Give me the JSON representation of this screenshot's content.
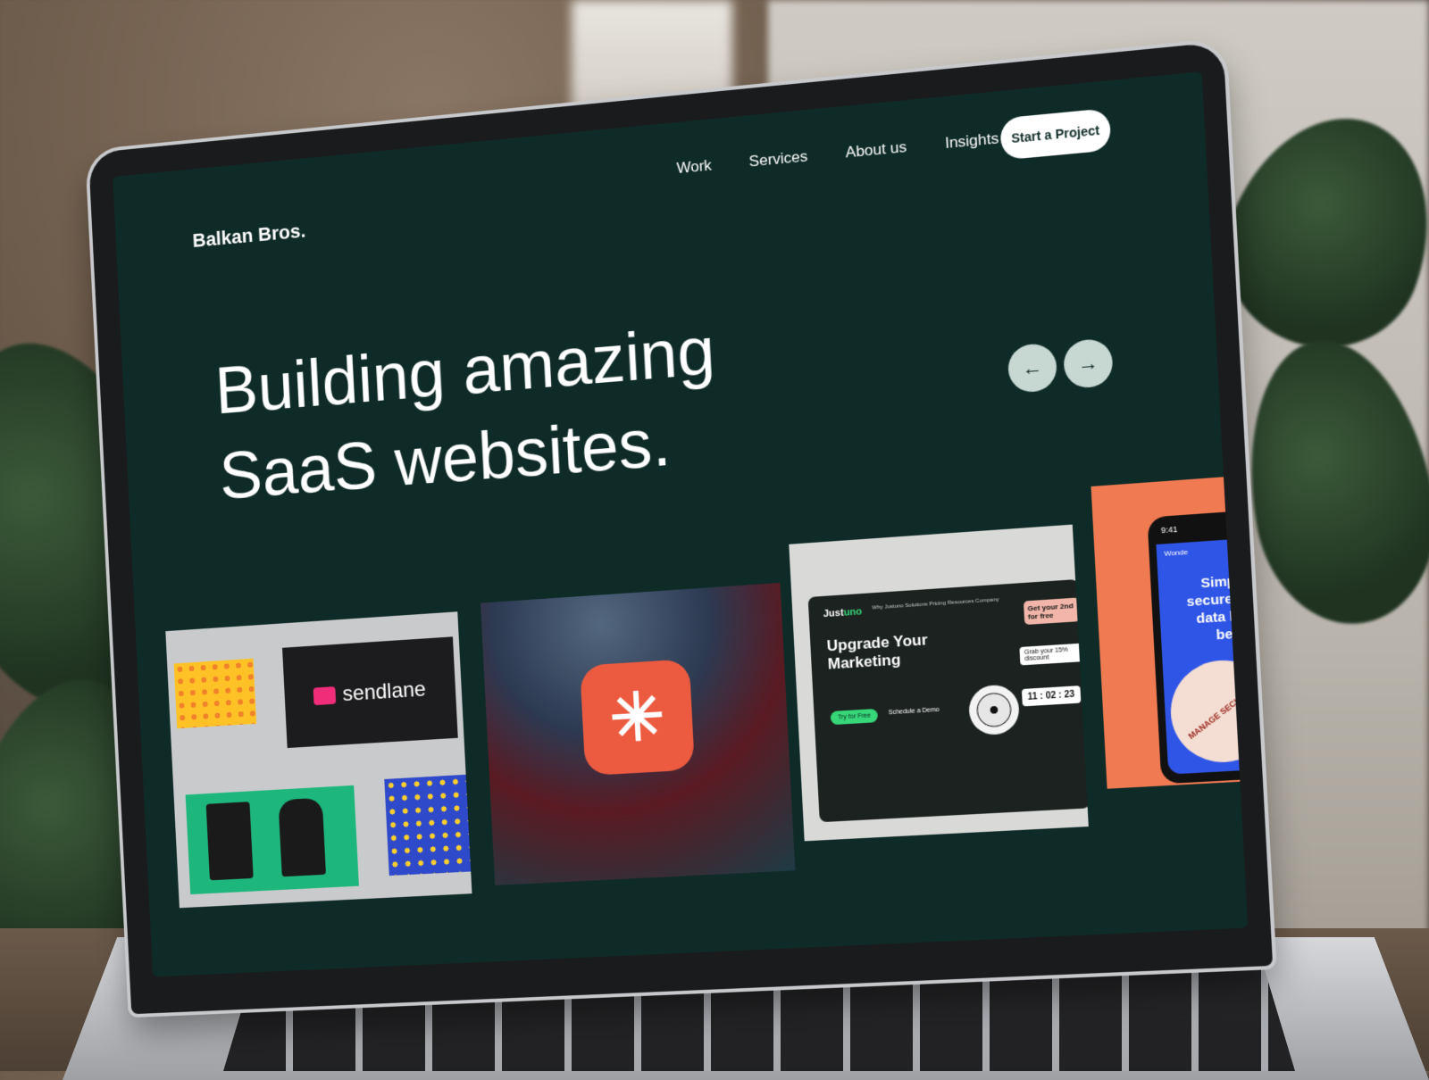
{
  "site": {
    "brand": "Balkan Bros.",
    "nav": [
      {
        "label": "Work"
      },
      {
        "label": "Services"
      },
      {
        "label": "About us"
      },
      {
        "label": "Insights"
      }
    ],
    "cta_label": "Start a Project",
    "hero_line1": "Building amazing",
    "hero_line2": "SaaS websites.",
    "arrows": {
      "prev": "←",
      "next": "→"
    }
  },
  "cards": {
    "sendlane": {
      "wordmark": "sendlane"
    },
    "app_icon": {
      "glyph": "✳"
    },
    "justuno": {
      "logo_main": "Just",
      "logo_accent": "uno",
      "menu": "Why Justuno   Solutions   Pricing   Resources   Company",
      "heading": "Upgrade Your Marketing",
      "primary_btn": "Try for Free",
      "secondary_btn": "Schedule a Demo",
      "discount": "Grab your 15% discount",
      "promo": "Get your 2nd for free",
      "timer": "11 : 02 : 23"
    },
    "phone": {
      "time": "9:41",
      "header": "Wonde",
      "text": "Simpli securely data lik befo",
      "badge": "MANAGE SECURELY"
    }
  },
  "colors": {
    "site_background": "#0f2b27",
    "accent_orange": "#ec5b3f",
    "accent_green": "#36d679"
  }
}
